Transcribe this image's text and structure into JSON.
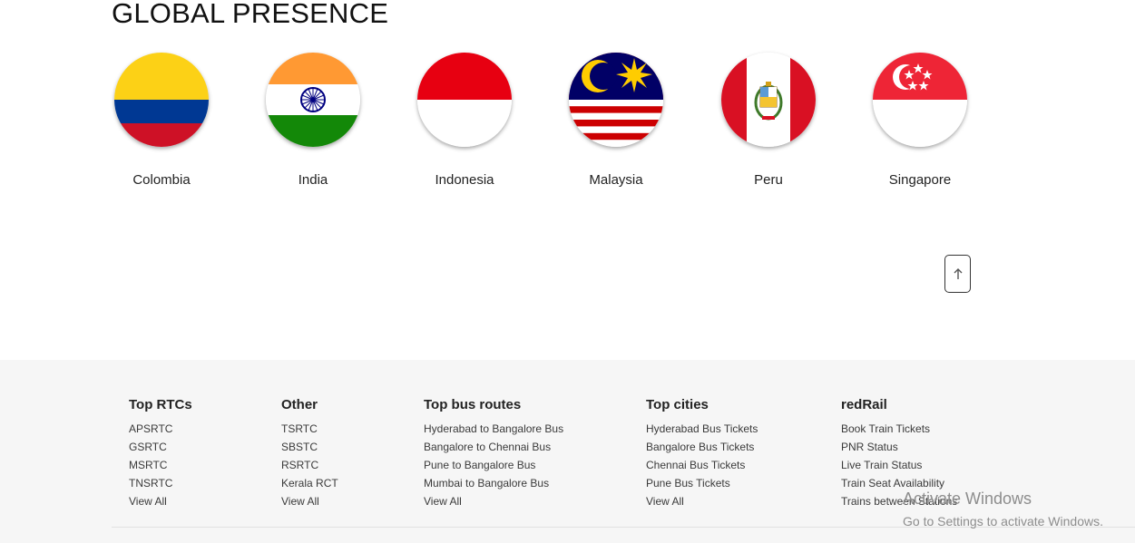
{
  "section_title": "GLOBAL PRESENCE",
  "countries": [
    {
      "name": "Colombia"
    },
    {
      "name": "India"
    },
    {
      "name": "Indonesia"
    },
    {
      "name": "Malaysia"
    },
    {
      "name": "Peru"
    },
    {
      "name": "Singapore"
    }
  ],
  "scroll_top_icon": "arrow-up-icon",
  "footer": {
    "columns": [
      {
        "title": "Top RTCs",
        "links": [
          "APSRTC",
          "GSRTC",
          "MSRTC",
          "TNSRTC",
          "View All"
        ]
      },
      {
        "title": "Other",
        "links": [
          "TSRTC",
          "SBSTC",
          "RSRTC",
          "Kerala RCT",
          "View All"
        ]
      },
      {
        "title": "Top bus routes",
        "links": [
          "Hyderabad to Bangalore Bus",
          "Bangalore to Chennai Bus",
          "Pune to Bangalore Bus",
          "Mumbai to Bangalore Bus",
          "View All"
        ]
      },
      {
        "title": "Top cities",
        "links": [
          "Hyderabad Bus Tickets",
          "Bangalore Bus Tickets",
          "Chennai Bus Tickets",
          "Pune Bus Tickets",
          "View All"
        ]
      },
      {
        "title": "redRail",
        "links": [
          "Book Train Tickets",
          "PNR Status",
          "Live Train Status",
          "Train Seat Availability",
          "Trains between Stations"
        ]
      }
    ]
  },
  "watermark": {
    "line1": "Activate Windows",
    "line2": "Go to Settings to activate Windows."
  },
  "colors": {
    "footer_bg": "#f6f6f6",
    "red": "#e30613",
    "india_saffron": "#ff9933",
    "india_green": "#138808",
    "colombia_yellow": "#fcd116",
    "colombia_blue": "#003893",
    "colombia_red": "#ce1126"
  }
}
